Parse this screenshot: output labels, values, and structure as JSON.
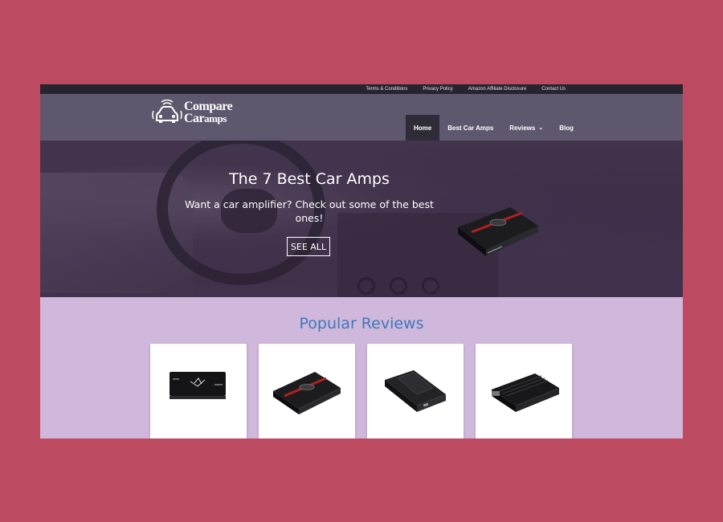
{
  "topbar": {
    "links": [
      "Terms & Conditions",
      "Privacy Policy",
      "Amazon Affiliate Disclosure",
      "Contact Us"
    ]
  },
  "logo": {
    "line1": "Compare",
    "line2_a": "Car",
    "line2_b": "amps",
    "icon": "car-speaker-icon"
  },
  "nav": {
    "items": [
      {
        "label": "Home",
        "active": true
      },
      {
        "label": "Best Car Amps",
        "active": false
      },
      {
        "label": "Reviews",
        "active": false,
        "dropdown": true
      },
      {
        "label": "Blog",
        "active": false
      }
    ]
  },
  "hero": {
    "title": "The 7 Best Car Amps",
    "subtitle": "Want a car amplifier? Check out some of the best ones!",
    "button": "SEE ALL"
  },
  "popular": {
    "title": "Popular Reviews",
    "cards": [
      {
        "image": "amplifier-image-1"
      },
      {
        "image": "amplifier-image-2"
      },
      {
        "image": "amplifier-image-3"
      },
      {
        "image": "amplifier-image-4"
      }
    ]
  },
  "colors": {
    "background": "#bc4a60",
    "topbar": "#26242f",
    "header": "#5f576e",
    "nav_active": "#2f2c38",
    "popular_bg": "#cfb8dc",
    "popular_title": "#3f78b8"
  }
}
